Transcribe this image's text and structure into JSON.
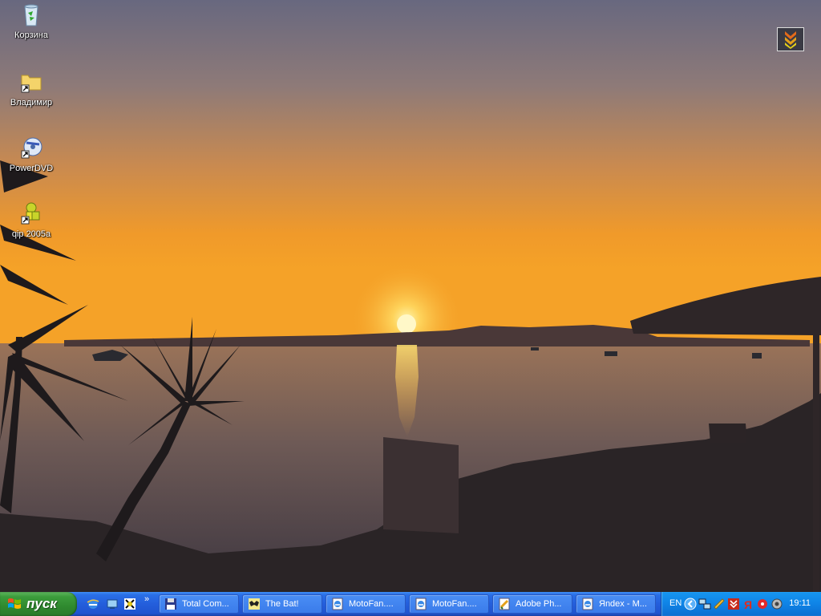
{
  "desktop": {
    "icons": [
      {
        "label": "Корзина",
        "icon": "recycle-bin-icon"
      },
      {
        "label": "Владимир",
        "icon": "folder-shortcut-icon"
      },
      {
        "label": "PowerDVD",
        "icon": "powerdvd-icon"
      },
      {
        "label": "qip 2005a",
        "icon": "qip-icon"
      }
    ],
    "corner_widget_icon": "download-arrows-icon"
  },
  "taskbar": {
    "start_label": "пуск",
    "quick_launch": [
      "ie-icon",
      "show-desktop-icon",
      "app-icon",
      "more-chevron-icon"
    ],
    "more_label": "»",
    "tasks": [
      {
        "label": "Total Com...",
        "icon": "floppy-icon"
      },
      {
        "label": "The Bat!",
        "icon": "bat-icon"
      },
      {
        "label": "MotoFan....",
        "icon": "ie-page-icon"
      },
      {
        "label": "MotoFan....",
        "icon": "ie-page-icon"
      },
      {
        "label": "Adobe Ph...",
        "icon": "photoshop-icon"
      },
      {
        "label": "Яndex - M...",
        "icon": "ie-page-icon"
      }
    ],
    "tray": {
      "lang": "EN",
      "clock": "19:11"
    }
  },
  "colors": {
    "sky_top": "#6e6e88",
    "sky_mid": "#d88c3c",
    "sun": "#ffe070",
    "taskbar": "#245edc",
    "start": "#3c9c3c",
    "tray": "#0f83e6"
  }
}
